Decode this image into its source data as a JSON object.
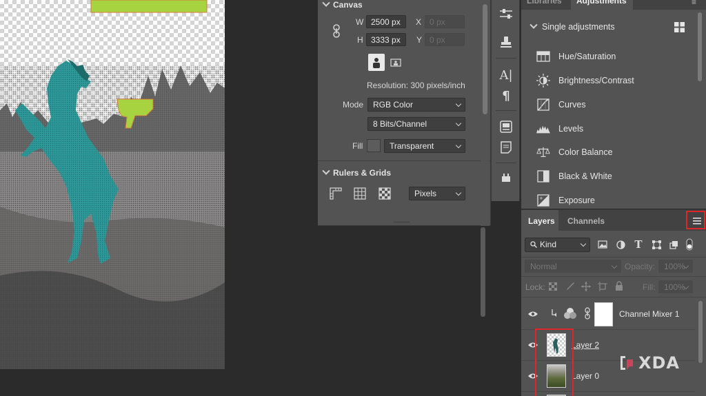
{
  "canvas_image": {
    "description_icon": "rearing-horse-photo",
    "colors": {
      "horse": "#2f9a9a",
      "highlight": "#a8d341",
      "field": "#8a8888"
    }
  },
  "properties": {
    "canvas": {
      "title": "Canvas",
      "w_label": "W",
      "w_value": "2500 px",
      "h_label": "H",
      "h_value": "3333 px",
      "x_label": "X",
      "x_placeholder": "0 px",
      "y_label": "Y",
      "y_placeholder": "0 px",
      "resolution": "Resolution: 300 pixels/inch",
      "mode_label": "Mode",
      "mode_value": "RGB Color",
      "bits_value": "8 Bits/Channel",
      "fill_label": "Fill",
      "fill_value": "Transparent"
    },
    "rulers": {
      "title": "Rulers & Grids",
      "units_value": "Pixels"
    }
  },
  "tool_strip": [
    "adjust-icon",
    "stamp-icon",
    "character-icon",
    "paragraph-icon",
    "library-icon",
    "notes-icon",
    "tool-preset-icon"
  ],
  "adjustments": {
    "tabs": [
      "Libraries",
      "Adjustments"
    ],
    "header": "Single adjustments",
    "items": [
      {
        "label": "Hue/Saturation",
        "icon": "hue-saturation-icon"
      },
      {
        "label": "Brightness/Contrast",
        "icon": "brightness-icon"
      },
      {
        "label": "Curves",
        "icon": "curves-icon"
      },
      {
        "label": "Levels",
        "icon": "levels-icon"
      },
      {
        "label": "Color Balance",
        "icon": "balance-icon"
      },
      {
        "label": "Black & White",
        "icon": "black-white-icon"
      },
      {
        "label": "Exposure",
        "icon": "exposure-icon"
      }
    ]
  },
  "layers": {
    "tabs": [
      "Layers",
      "Channels"
    ],
    "filter_value": "Kind",
    "blend_mode": "Normal",
    "opacity_label": "Opacity:",
    "opacity_value": "100%",
    "lock_label": "Lock:",
    "fill_label": "Fill:",
    "fill_value": "100%",
    "rows": [
      {
        "name": "Channel Mixer 1"
      },
      {
        "name": "Layer 2"
      },
      {
        "name": "Layer 0"
      }
    ]
  },
  "watermark": {
    "text": "XDA"
  },
  "accent": {
    "highlight_red": "#e0262b"
  }
}
